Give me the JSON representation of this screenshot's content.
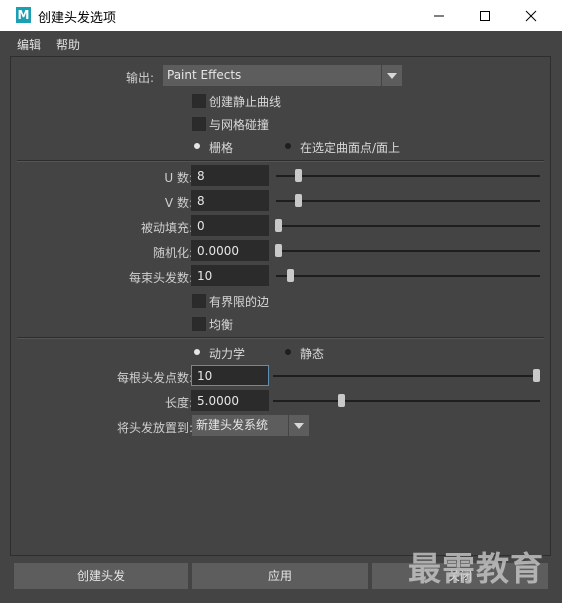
{
  "window": {
    "title": "创建头发选项",
    "app_icon_letter": "M",
    "controls": {
      "minimize": "minimize-icon",
      "maximize": "maximize-icon",
      "close": "close-icon"
    }
  },
  "menubar": {
    "items": [
      "编辑",
      "帮助"
    ]
  },
  "output": {
    "label": "输出:",
    "value": "Paint Effects"
  },
  "options1": {
    "static_curves": {
      "label": "创建静止曲线",
      "checked": false
    },
    "mesh_collide": {
      "label": "与网格碰撞",
      "checked": false
    }
  },
  "placement": {
    "grid": {
      "label": "栅格",
      "selected": true
    },
    "selected_points": {
      "label": "在选定曲面点/面上",
      "selected": false
    }
  },
  "grid_params": {
    "u_count": {
      "label": "U 数:",
      "value": "8",
      "slider": 0.08
    },
    "v_count": {
      "label": "V 数:",
      "value": "8",
      "slider": 0.08
    },
    "passive_fill": {
      "label": "被动填充:",
      "value": "0",
      "slider": 0.0
    },
    "randomization": {
      "label": "随机化:",
      "value": "0.0000",
      "slider": 0.0
    },
    "hairs_per_clump": {
      "label": "每束头发数:",
      "value": "10",
      "slider": 0.05
    }
  },
  "options2": {
    "bounded_edges": {
      "label": "有界限的边",
      "checked": false
    },
    "equalize": {
      "label": "均衡",
      "checked": false
    }
  },
  "dynamics": {
    "dynamic": {
      "label": "动力学",
      "selected": true
    },
    "static": {
      "label": "静态",
      "selected": false
    }
  },
  "hair_params": {
    "points_per_hair": {
      "label": "每根头发点数:",
      "value": "10",
      "slider": 1.0
    },
    "length": {
      "label": "长度:",
      "value": "5.0000",
      "slider": 0.26
    }
  },
  "place_into": {
    "label": "将头发放置到:",
    "value": "新建头发系统"
  },
  "buttons": {
    "create": "创建头发",
    "apply": "应用",
    "close": "关闭"
  },
  "watermark": "最需教育",
  "colors": {
    "background": "#444444",
    "field": "#2b2b2b",
    "button": "#5d5d5d",
    "focus": "#5d8fb3",
    "app_icon": "#1a9fb5"
  }
}
